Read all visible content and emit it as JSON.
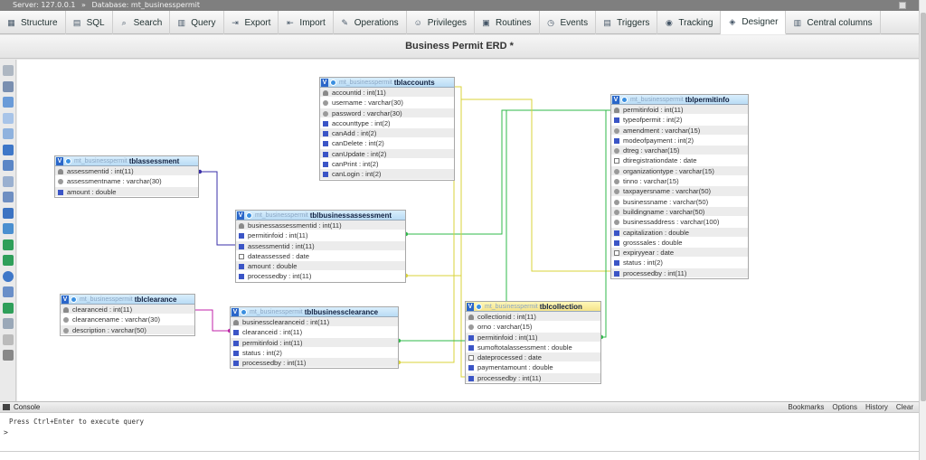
{
  "breadcrumb": {
    "server": "Server: 127.0.0.1",
    "database": "Database: mt_businesspermit"
  },
  "tabs": [
    {
      "label": "Structure",
      "icon": "structure-icon"
    },
    {
      "label": "SQL",
      "icon": "sql-icon"
    },
    {
      "label": "Search",
      "icon": "search-icon"
    },
    {
      "label": "Query",
      "icon": "query-icon"
    },
    {
      "label": "Export",
      "icon": "export-icon"
    },
    {
      "label": "Import",
      "icon": "import-icon"
    },
    {
      "label": "Operations",
      "icon": "wrench-icon"
    },
    {
      "label": "Privileges",
      "icon": "privileges-icon"
    },
    {
      "label": "Routines",
      "icon": "routines-icon"
    },
    {
      "label": "Events",
      "icon": "clock-icon"
    },
    {
      "label": "Triggers",
      "icon": "triggers-icon"
    },
    {
      "label": "Tracking",
      "icon": "eye-icon"
    },
    {
      "label": "Designer",
      "icon": "designer-icon",
      "active": true
    },
    {
      "label": "Central columns",
      "icon": "columns-icon"
    }
  ],
  "designer_title": "Business Permit ERD *",
  "db_prefix": "mt_businesspermit",
  "tables": {
    "tblaccounts": {
      "name": "tblaccounts",
      "columns": [
        "accountid : int(11)",
        "username : varchar(30)",
        "password : varchar(30)",
        "accounttype : int(2)",
        "canAdd : int(2)",
        "canDelete : int(2)",
        "canUpdate : int(2)",
        "canPrint : int(2)",
        "canLogin : int(2)"
      ],
      "types": [
        "key",
        "str",
        "str",
        "num",
        "num",
        "num",
        "num",
        "num",
        "num"
      ]
    },
    "tblassessment": {
      "name": "tblassessment",
      "columns": [
        "assessmentid : int(11)",
        "assessmentname : varchar(30)",
        "amount : double"
      ],
      "types": [
        "key",
        "str",
        "num"
      ]
    },
    "tblbusinessassessment": {
      "name": "tblbusinessassessment",
      "columns": [
        "businessassessmentid : int(11)",
        "permitinfoid : int(11)",
        "assessmentid : int(11)",
        "dateassessed : date",
        "amount : double",
        "processedby : int(11)"
      ],
      "types": [
        "key",
        "num",
        "num",
        "date",
        "num",
        "num"
      ]
    },
    "tblpermitinfo": {
      "name": "tblpermitinfo",
      "columns": [
        "permitinfoid : int(11)",
        "typeofpermit : int(2)",
        "amendment : varchar(15)",
        "modeofpayment : int(2)",
        "dtreg : varchar(15)",
        "dtiregistrationdate : date",
        "organizationtype : varchar(15)",
        "tinno : varchar(15)",
        "taxpayersname : varchar(50)",
        "businessname : varchar(50)",
        "buildingname : varchar(50)",
        "businessaddress : varchar(100)",
        "capitalization : double",
        "grosssales : double",
        "expiryyear : date",
        "status : int(2)",
        "processedby : int(11)"
      ],
      "types": [
        "key",
        "num",
        "str",
        "num",
        "str",
        "date",
        "str",
        "str",
        "str",
        "str",
        "str",
        "str",
        "num",
        "num",
        "date",
        "num",
        "num"
      ]
    },
    "tblclearance": {
      "name": "tblclearance",
      "columns": [
        "clearanceid : int(11)",
        "clearancename : varchar(30)",
        "description : varchar(50)"
      ],
      "types": [
        "key",
        "str",
        "str"
      ]
    },
    "tblbusinessclearance": {
      "name": "tblbusinessclearance",
      "columns": [
        "businessclearanceid : int(11)",
        "clearanceid : int(11)",
        "permitinfoid : int(11)",
        "status : int(2)",
        "processedby : int(11)"
      ],
      "types": [
        "key",
        "num",
        "num",
        "num",
        "num"
      ]
    },
    "tblcollection": {
      "name": "tblcollection",
      "columns": [
        "collectionid : int(11)",
        "orno : varchar(15)",
        "permitinfoid : int(11)",
        "sumoftotalassessment : double",
        "dateprocessed : date",
        "paymentamount : double",
        "processedby : int(11)"
      ],
      "types": [
        "key",
        "str",
        "num",
        "num",
        "date",
        "num",
        "num"
      ]
    }
  },
  "relation_colors": {
    "assessment": "#3a2fa8",
    "permitinfo": "#2fb94a",
    "accounts": "#d8d33a",
    "clearance": "#c020a8"
  },
  "console": {
    "title": "Console",
    "hint": "Press Ctrl+Enter to execute query",
    "prompt": ">",
    "actions": [
      "Bookmarks",
      "Options",
      "History",
      "Clear"
    ]
  }
}
